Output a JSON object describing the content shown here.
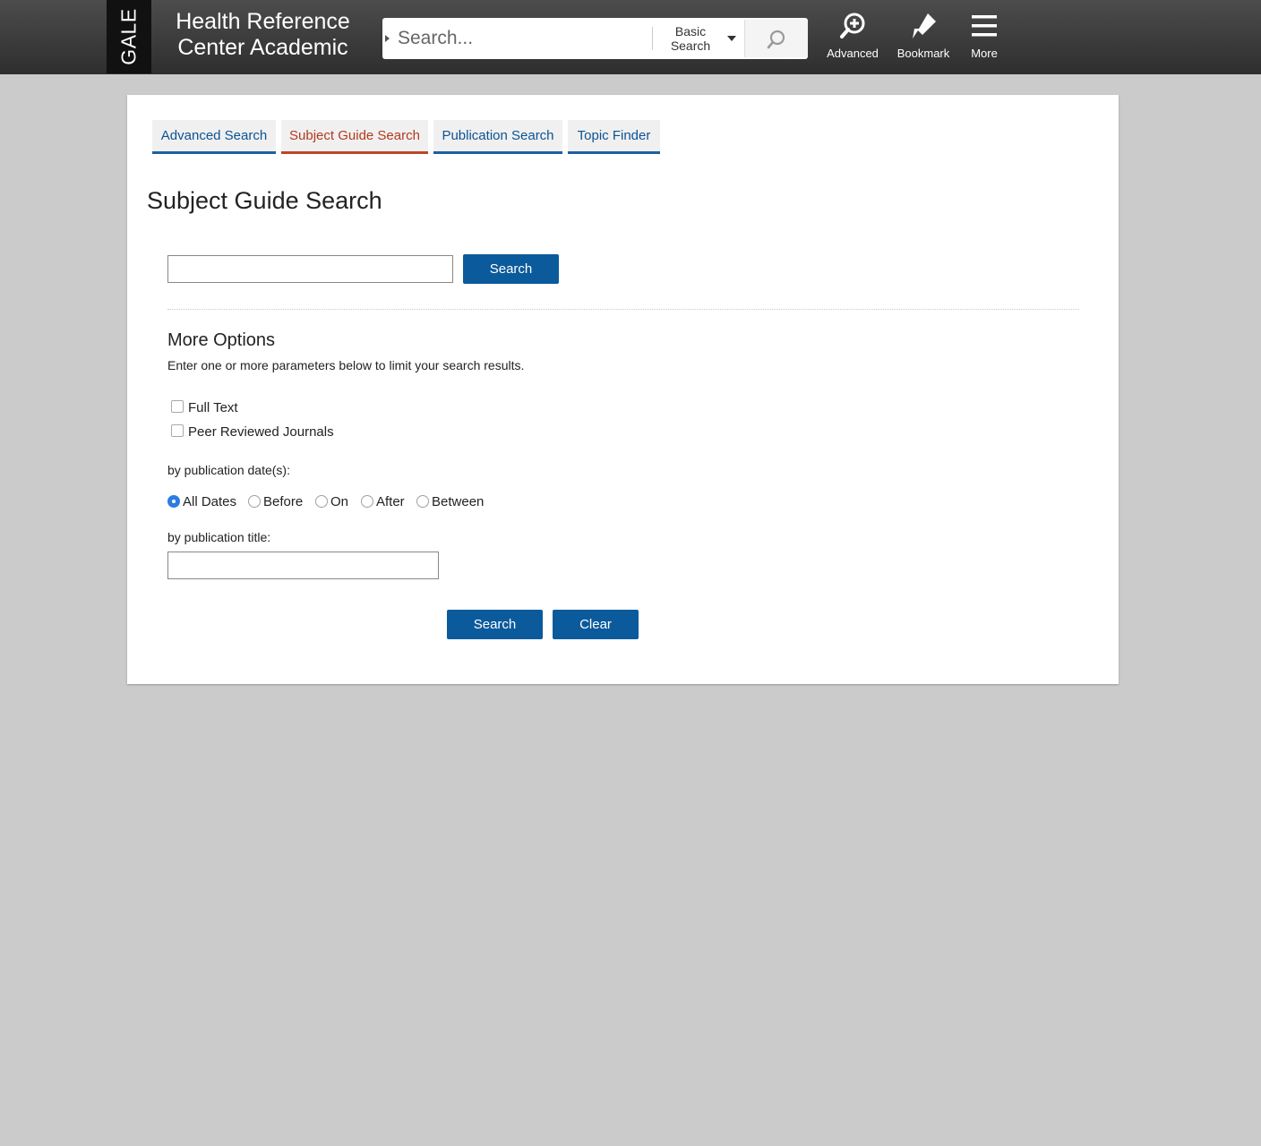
{
  "header": {
    "logo_text": "GALE",
    "title_line1": "Health Reference",
    "title_line2": "Center Academic",
    "search": {
      "placeholder": "Search...",
      "mode_line1": "Basic",
      "mode_line2": "Search"
    },
    "tools": [
      {
        "label": "Advanced",
        "icon": "advanced-search-icon"
      },
      {
        "label": "Bookmark",
        "icon": "bookmark-icon"
      },
      {
        "label": "More",
        "icon": "menu-icon"
      }
    ]
  },
  "tabs": [
    {
      "label": "Advanced Search",
      "active": false
    },
    {
      "label": "Subject Guide Search",
      "active": true
    },
    {
      "label": "Publication Search",
      "active": false
    },
    {
      "label": "Topic Finder",
      "active": false
    }
  ],
  "page_title": "Subject Guide Search",
  "main_search": {
    "value": "",
    "button_label": "Search"
  },
  "more_options": {
    "title": "More Options",
    "description": "Enter one or more parameters below to limit your search results.",
    "checkboxes": [
      {
        "label": "Full Text",
        "checked": false
      },
      {
        "label": "Peer Reviewed Journals",
        "checked": false
      }
    ],
    "date_label": "by publication date(s):",
    "date_options": [
      {
        "label": "All Dates",
        "checked": true
      },
      {
        "label": "Before",
        "checked": false
      },
      {
        "label": "On",
        "checked": false
      },
      {
        "label": "After",
        "checked": false
      },
      {
        "label": "Between",
        "checked": false
      }
    ],
    "title_label": "by publication title:",
    "title_value": ""
  },
  "actions": {
    "search_label": "Search",
    "clear_label": "Clear"
  },
  "colors": {
    "header_bg": "#3d3c3c",
    "tab_link": "#0b5394",
    "tab_active": "#b23a1e",
    "button_bg": "#0b5a9c",
    "page_bg": "#cbcbcb",
    "radio_checked": "#2b7de1"
  }
}
